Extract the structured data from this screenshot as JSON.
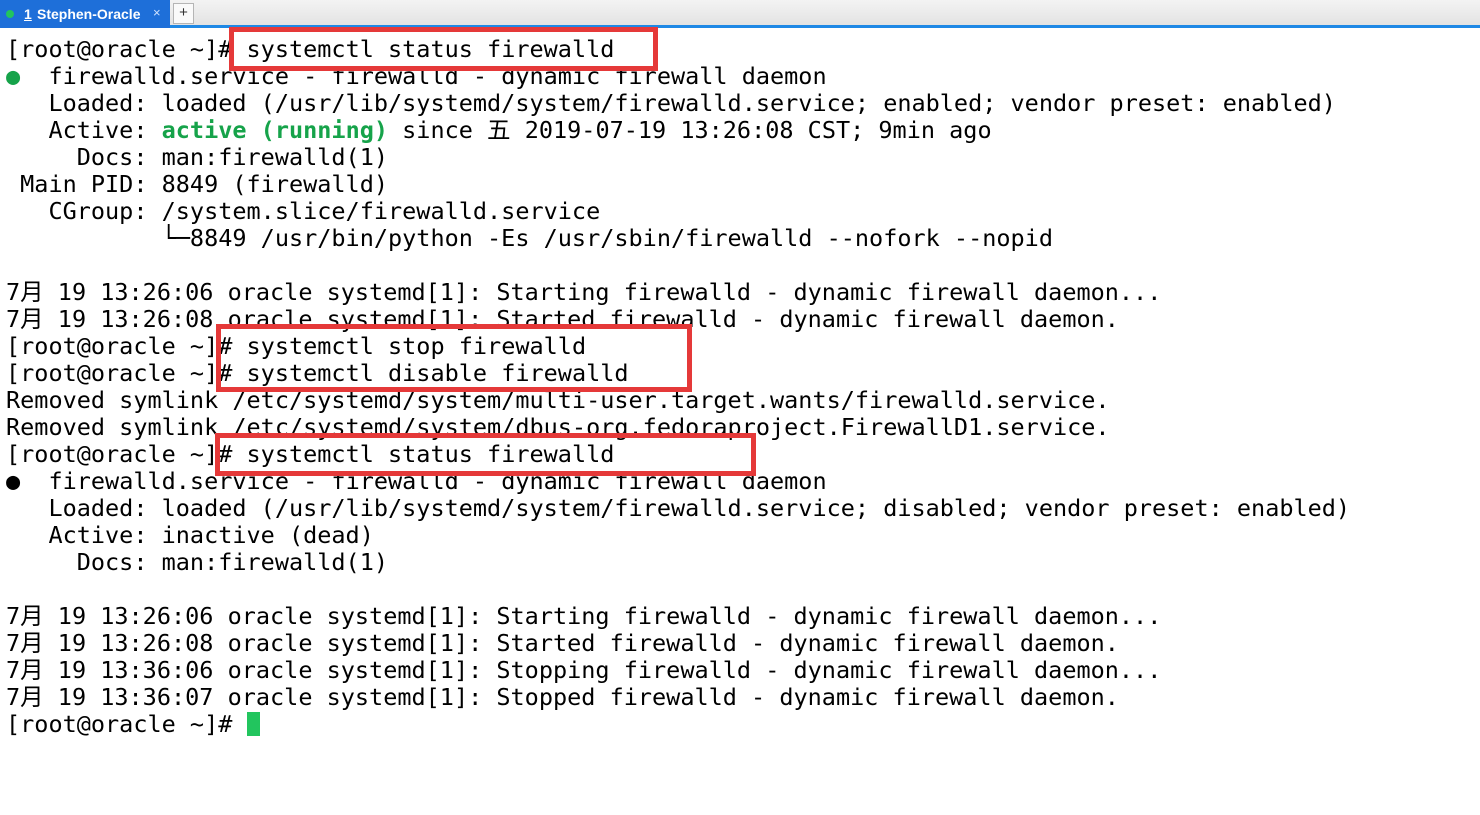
{
  "tab": {
    "number": "1",
    "title": "Stephen-Oracle",
    "close_glyph": "×",
    "status_color": "#22c55e"
  },
  "new_tab_glyph": "+",
  "terminal": {
    "prompt": "[root@oracle ~]# ",
    "lines": {
      "l1_cmd": "systemctl status firewalld",
      "l2_dot": "●",
      "l2_rest": "  firewalld.service - firewalld - dynamic firewall daemon",
      "l3": "   Loaded: loaded (/usr/lib/systemd/system/firewalld.service; enabled; vendor preset: enabled)",
      "l4_prefix": "   Active: ",
      "l4_active": "active (running)",
      "l4_suffix": " since 五 2019-07-19 13:26:08 CST; 9min ago",
      "l5": "     Docs: man:firewalld(1)",
      "l6": " Main PID: 8849 (firewalld)",
      "l7": "   CGroup: /system.slice/firewalld.service",
      "l8": "           └─8849 /usr/bin/python -Es /usr/sbin/firewalld --nofork --nopid",
      "l10": "7月 19 13:26:06 oracle systemd[1]: Starting firewalld - dynamic firewall daemon...",
      "l11": "7月 19 13:26:08 oracle systemd[1]: Started firewalld - dynamic firewall daemon.",
      "l12_cmd": "systemctl stop firewalld",
      "l13_cmd": "systemctl disable firewalld",
      "l14": "Removed symlink /etc/systemd/system/multi-user.target.wants/firewalld.service.",
      "l15": "Removed symlink /etc/systemd/system/dbus-org.fedoraproject.FirewallD1.service.",
      "l16_cmd": "systemctl status firewalld",
      "l17_dot": "●",
      "l17_rest": "  firewalld.service - firewalld - dynamic firewall daemon",
      "l18": "   Loaded: loaded (/usr/lib/systemd/system/firewalld.service; disabled; vendor preset: enabled)",
      "l19": "   Active: inactive (dead)",
      "l20": "     Docs: man:firewalld(1)",
      "l22": "7月 19 13:26:06 oracle systemd[1]: Starting firewalld - dynamic firewall daemon...",
      "l23": "7月 19 13:26:08 oracle systemd[1]: Started firewalld - dynamic firewall daemon.",
      "l24": "7月 19 13:36:06 oracle systemd[1]: Stopping firewalld - dynamic firewall daemon...",
      "l25": "7月 19 13:36:07 oracle systemd[1]: Stopped firewalld - dynamic firewall daemon."
    },
    "colors": {
      "active_running": "#16a34a",
      "cursor": "#22c55e",
      "highlight_box": "#e53939",
      "tab_accent": "#1e6fd9"
    }
  }
}
